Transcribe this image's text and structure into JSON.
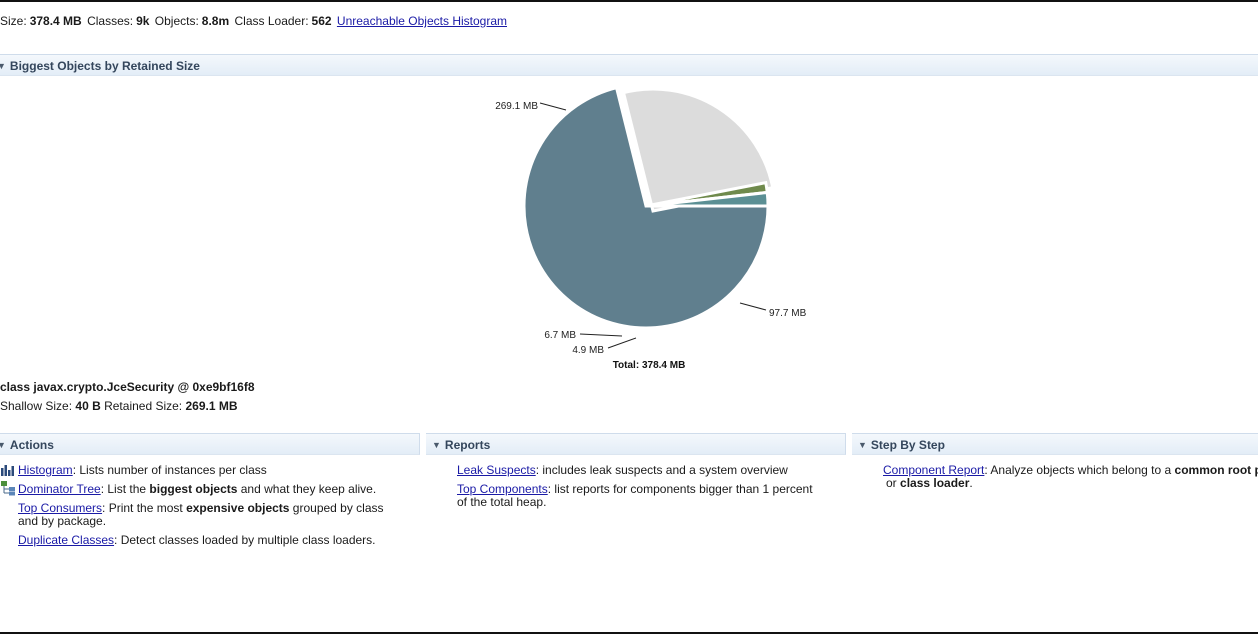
{
  "summary": {
    "size_label": "Size:",
    "size_value": "378.4 MB",
    "classes_label": "Classes:",
    "classes_value": "9k",
    "objects_label": "Objects:",
    "objects_value": "8.8m",
    "class_loader_label": "Class Loader:",
    "class_loader_value": "562",
    "unreachable_link": "Unreachable Objects Histogram"
  },
  "biggest_objects": {
    "title": "Biggest Objects by Retained Size"
  },
  "chart_data": {
    "type": "pie",
    "unit": "MB",
    "slices": [
      {
        "label": "269.1 MB",
        "value": 269.1,
        "color": "#607f8e"
      },
      {
        "label": "97.7 MB",
        "value": 97.7,
        "color": "#dcdcdc"
      },
      {
        "label": "4.9 MB",
        "value": 4.9,
        "color": "#6f8a4c"
      },
      {
        "label": "6.7 MB",
        "value": 6.7,
        "color": "#5b8f94"
      }
    ],
    "total_label": "Total: 378.4 MB"
  },
  "selected_object": {
    "name": "class javax.crypto.JceSecurity @ 0xe9bf16f8",
    "shallow_label": "Shallow Size:",
    "shallow_value": "40 B",
    "retained_label": "Retained Size:",
    "retained_value": "269.1 MB"
  },
  "actions": {
    "title": "Actions",
    "items": [
      {
        "link": "Histogram",
        "text": ": Lists number of instances per class",
        "icon": "histogram-icon"
      },
      {
        "link": "Dominator Tree",
        "text_a": ": List the ",
        "bold": "biggest objects",
        "text_b": " and what they keep alive.",
        "icon": "dominator-tree-icon"
      },
      {
        "link": "Top Consumers",
        "text_a": ": Print the most ",
        "bold": "expensive objects",
        "text_b": " grouped by class",
        "line2": "and by package."
      },
      {
        "link": "Duplicate Classes",
        "text": ": Detect classes loaded by multiple class loaders."
      }
    ]
  },
  "reports": {
    "title": "Reports",
    "items": [
      {
        "link": "Leak Suspects",
        "text": ": includes leak suspects and a system overview"
      },
      {
        "link": "Top Components",
        "text": ": list reports for components bigger than 1 percent",
        "line2": "of the total heap."
      }
    ]
  },
  "step_by_step": {
    "title": "Step By Step",
    "items": [
      {
        "link": "Component Report",
        "text_a": ": Analyze objects which belong to a ",
        "bold": "common root p",
        "line2_a": "or ",
        "line2_bold": "class loader",
        "line2_b": "."
      }
    ]
  },
  "colors": {
    "link": "#1a1aa6",
    "header_text": "#34465c",
    "header_bg": "#e3edf7"
  }
}
